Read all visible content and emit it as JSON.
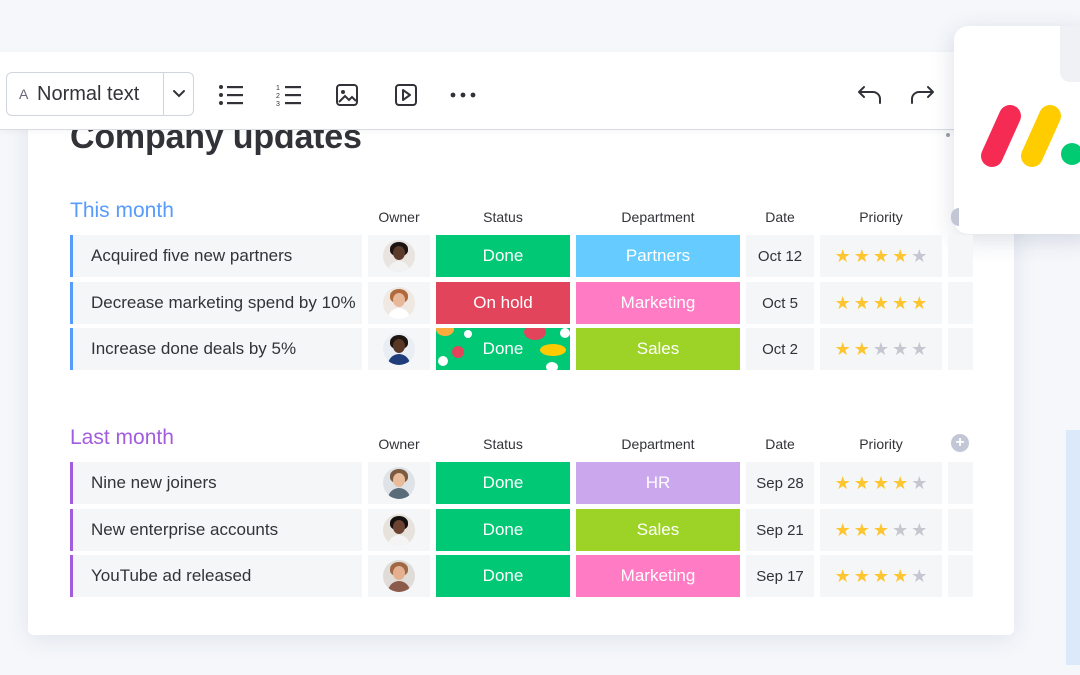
{
  "toolbar": {
    "text_style_glyph": "A",
    "text_style_label": "Normal text",
    "icons": [
      "chevron-down-icon",
      "bulleted-list-icon",
      "numbered-list-icon",
      "image-icon",
      "video-icon",
      "more-icon",
      "undo-icon",
      "redo-icon"
    ]
  },
  "page": {
    "title": "Company updates"
  },
  "columns": {
    "owner": "Owner",
    "status": "Status",
    "department": "Department",
    "date": "Date",
    "priority": "Priority"
  },
  "groups": [
    {
      "title": "This month",
      "color": "#579bfc",
      "rows": [
        {
          "name": "Acquired five new partners",
          "status": "Done",
          "status_color": "#00c875",
          "department": "Partners",
          "dept_color": "#66ccff",
          "date": "Oct 12",
          "priority": 4
        },
        {
          "name": "Decrease marketing spend by 10%",
          "status": "On hold",
          "status_color": "#e2445c",
          "department": "Marketing",
          "dept_color": "#ff7bc4",
          "date": "Oct 5",
          "priority": 5
        },
        {
          "name": "Increase done deals by 5%",
          "status": "Done",
          "status_color": "#00c875",
          "department": "Sales",
          "dept_color": "#9cd326",
          "date": "Oct 2",
          "priority": 2
        }
      ]
    },
    {
      "title": "Last month",
      "color": "#a25ddc",
      "rows": [
        {
          "name": "Nine new joiners",
          "status": "Done",
          "status_color": "#00c875",
          "department": "HR",
          "dept_color": "#cba8ee",
          "date": "Sep 28",
          "priority": 4
        },
        {
          "name": "New enterprise accounts",
          "status": "Done",
          "status_color": "#00c875",
          "department": "Sales",
          "dept_color": "#9cd326",
          "date": "Sep 21",
          "priority": 3
        },
        {
          "name": "YouTube ad released",
          "status": "Done",
          "status_color": "#00c875",
          "department": "Marketing",
          "dept_color": "#ff7bc4",
          "date": "Sep 17",
          "priority": 4
        }
      ]
    }
  ],
  "colors": {
    "star_on": "#fdc630",
    "star_off": "#c5c7d0",
    "brand_red": "#f62b54",
    "brand_yellow": "#ffcc00",
    "brand_green": "#00ca72"
  }
}
